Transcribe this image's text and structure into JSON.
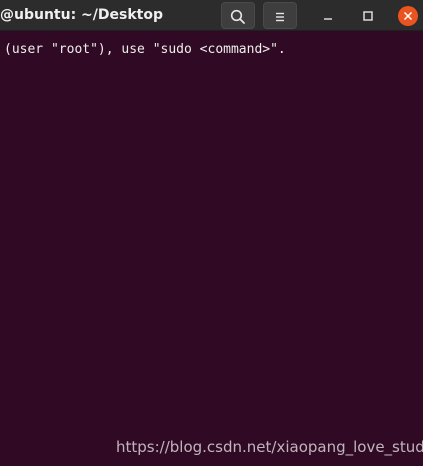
{
  "window": {
    "title": "@ubuntu: ~/Desktop"
  },
  "titlebar": {
    "icons": {
      "search": "search-icon",
      "menu": "hamburger-menu-icon",
      "minimize": "minimize-icon",
      "maximize": "maximize-icon",
      "close": "close-icon"
    }
  },
  "terminal": {
    "lines": [
      "(user \"root\"), use \"sudo <command>\"."
    ],
    "colors": {
      "background": "#300a24",
      "foreground": "#eeeeec"
    }
  },
  "watermark": {
    "text": "https://blog.csdn.net/xiaopang_love_study"
  },
  "colors": {
    "titlebar": "#2c2c2c",
    "close_button": "#e95420"
  }
}
